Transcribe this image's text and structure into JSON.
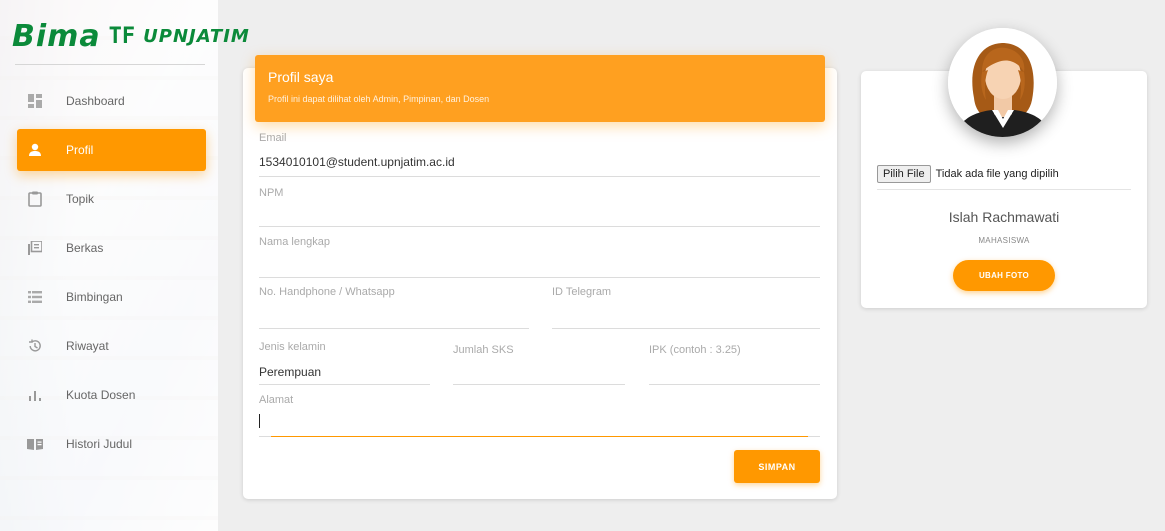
{
  "brand": {
    "name": "Bima",
    "mark": "TF",
    "org": "UPNJATIM"
  },
  "sidebar": {
    "items": [
      {
        "label": "Dashboard",
        "icon": "dashboard-icon",
        "active": false
      },
      {
        "label": "Profil",
        "icon": "person-icon",
        "active": true
      },
      {
        "label": "Topik",
        "icon": "clipboard-icon",
        "active": false
      },
      {
        "label": "Berkas",
        "icon": "library-books-icon",
        "active": false
      },
      {
        "label": "Bimbingan",
        "icon": "list-icon",
        "active": false
      },
      {
        "label": "Riwayat",
        "icon": "history-icon",
        "active": false
      },
      {
        "label": "Kuota Dosen",
        "icon": "bar-chart-icon",
        "active": false
      },
      {
        "label": "Histori Judul",
        "icon": "book-icon",
        "active": false
      }
    ]
  },
  "profile_card": {
    "title": "Profil saya",
    "subtitle": "Profil ini dapat dilihat oleh Admin, Pimpinan, dan Dosen",
    "fields": {
      "email": {
        "label": "Email",
        "value": "1534010101@student.upnjatim.ac.id"
      },
      "npm": {
        "label": "NPM",
        "value": ""
      },
      "nama": {
        "label": "Nama lengkap",
        "value": ""
      },
      "phone": {
        "label": "No. Handphone / Whatsapp",
        "value": ""
      },
      "telegram": {
        "label": "ID Telegram",
        "value": ""
      },
      "gender": {
        "label": "Jenis kelamin",
        "value": "Perempuan"
      },
      "sks": {
        "label": "Jumlah SKS",
        "value": ""
      },
      "ipk": {
        "label": "IPK (contoh : 3.25)",
        "value": ""
      },
      "alamat": {
        "label": "Alamat",
        "value": ""
      }
    },
    "save_label": "SIMPAN"
  },
  "side_card": {
    "file_button": "Pilih File",
    "file_status": "Tidak ada file yang dipilih",
    "name": "Islah Rachmawati",
    "role": "MAHASISWA",
    "change_photo_label": "UBAH FOTO"
  },
  "colors": {
    "accent": "#ff9800",
    "brand_green": "#0b8a3a"
  }
}
